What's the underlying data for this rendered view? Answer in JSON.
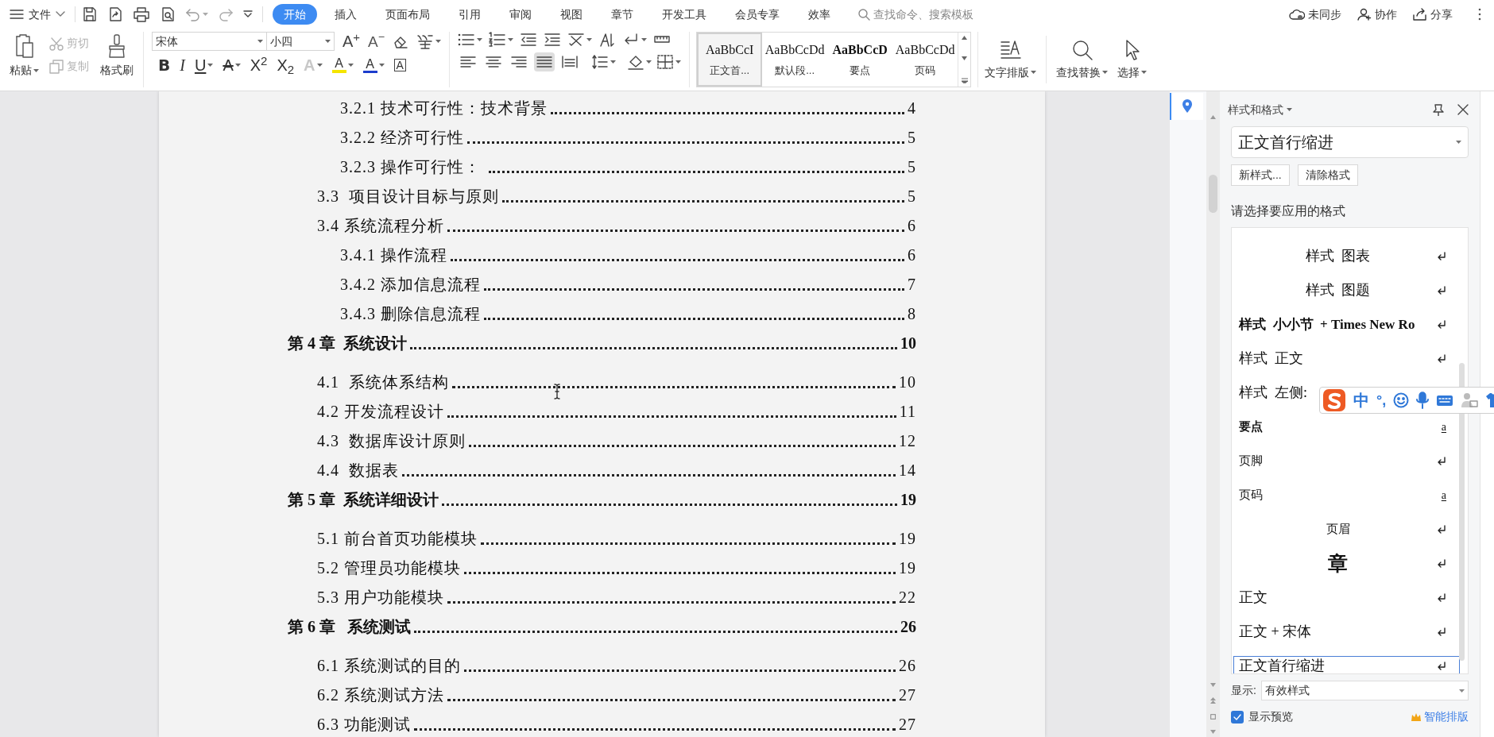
{
  "menu_bar": {
    "file_menu": "文件",
    "tabs": [
      {
        "label": "开始",
        "selected": true
      },
      {
        "label": "插入",
        "selected": false
      },
      {
        "label": "页面布局",
        "selected": false
      },
      {
        "label": "引用",
        "selected": false
      },
      {
        "label": "审阅",
        "selected": false
      },
      {
        "label": "视图",
        "selected": false
      },
      {
        "label": "章节",
        "selected": false
      },
      {
        "label": "开发工具",
        "selected": false
      },
      {
        "label": "会员专享",
        "selected": false
      },
      {
        "label": "效率",
        "selected": false
      }
    ],
    "search": {
      "placeholder": "查找命令、搜索模板"
    },
    "actions": [
      "未同步",
      "协作",
      "分享"
    ]
  },
  "ribbon": {
    "clipboard": {
      "paste": "粘贴",
      "cut": {
        "label": "剪切",
        "disabled": true
      },
      "copy": {
        "label": "复制",
        "disabled": true
      },
      "format_painter": "格式刷"
    },
    "font": {
      "name": "宋体",
      "size": "小四",
      "size_glyphs": [
        {
          "glyph": "A$^{+}$",
          "kind": "grow"
        },
        {
          "glyph": "A$^{−}$",
          "kind": "shrink"
        }
      ],
      "format_glyphs": [
        {
          "glyph": "B",
          "kind": "bold"
        },
        {
          "glyph": "I",
          "kind": "italic"
        },
        {
          "glyph": "U",
          "kind": "underline"
        },
        {
          "glyph": "A",
          "kind": "strike"
        },
        {
          "glyph": "X$^{2}$",
          "kind": "super"
        },
        {
          "glyph": "X$_{2}$",
          "kind": "sub"
        },
        {
          "glyph": "A",
          "kind": "effect"
        },
        {
          "glyph": "A",
          "kind": "highlight"
        },
        {
          "glyph": "A",
          "kind": "color"
        },
        {
          "glyph": "A",
          "kind": "border"
        }
      ]
    },
    "alignment": [
      {
        "selected": false
      },
      {
        "selected": false
      },
      {
        "selected": false
      },
      {
        "selected": true
      },
      {
        "selected": false
      }
    ],
    "styles": [
      {
        "sample": "AaBbCcI",
        "label": "正文首...",
        "kind": "normal",
        "selected": true
      },
      {
        "sample": "AaBbCcDd",
        "label": "默认段...",
        "kind": "normal",
        "selected": false
      },
      {
        "sample": "AaBbCcD",
        "label": "要点",
        "kind": "bold",
        "selected": false
      },
      {
        "sample": "AaBbCcDd",
        "label": "页码",
        "kind": "normal",
        "selected": false
      }
    ],
    "text_layout": "文字排版",
    "find_replace": "查找替换",
    "select": "选择"
  },
  "document": {
    "toc": [
      {
        "children": [
          {
            "children": [
              {
                "title": "3.2.1 技术可行性：技术背景",
                "page": "4"
              },
              {
                "title": "3.2.2 经济可行性",
                "page": "5"
              },
              {
                "title": "3.2.3 操作可行性： ",
                "page": "5"
              }
            ]
          },
          {
            "title": "3.3  项目设计目标与原则",
            "page": "5"
          },
          {
            "title": "3.4 系统流程分析",
            "page": "6",
            "children": [
              {
                "title": "3.4.1 操作流程",
                "page": "6"
              },
              {
                "title": "3.4.2 添加信息流程",
                "page": "7"
              },
              {
                "title": "3.4.3 删除信息流程",
                "page": "8"
              }
            ]
          }
        ]
      },
      {
        "title": "第 4 章  系统设计",
        "page": "10",
        "children": [
          {
            "title": "4.1  系统体系结构",
            "page": "10"
          },
          {
            "title": "4.2 开发流程设计",
            "page": "11"
          },
          {
            "title": "4.3  数据库设计原则",
            "page": "12"
          },
          {
            "title": "4.4  数据表",
            "page": "14"
          }
        ]
      },
      {
        "title": "第 5 章  系统详细设计",
        "page": "19",
        "children": [
          {
            "title": "5.1 前台首页功能模块",
            "page": "19"
          },
          {
            "title": "5.2 管理员功能模块",
            "page": "19"
          },
          {
            "title": "5.3 用户功能模块",
            "page": "22"
          }
        ]
      },
      {
        "title": "第 6 章   系统测试",
        "page": "26",
        "children": [
          {
            "title": "6.1 系统测试的目的",
            "page": "26"
          },
          {
            "title": "6.2 系统测试方法",
            "page": "27"
          },
          {
            "title": "6.3 功能测试",
            "page": "27"
          }
        ]
      }
    ]
  },
  "styles_pane": {
    "title": "样式和格式",
    "current_style": "正文首行缩进",
    "buttons": [
      "新样式...",
      "清除格式"
    ],
    "list_label": "请选择要应用的格式",
    "styles": [
      {
        "name": "样式  图表",
        "kind": "paragraph",
        "centered": true,
        "bold": false,
        "small": false,
        "large": false,
        "selected": false
      },
      {
        "name": "样式  图题",
        "kind": "paragraph",
        "centered": true,
        "bold": false,
        "small": false,
        "large": false,
        "selected": false
      },
      {
        "name": "样式  小小节  + Times New Ro",
        "kind": "paragraph",
        "centered": false,
        "bold": true,
        "small": false,
        "large": false,
        "selected": false
      },
      {
        "name": "样式  正文",
        "kind": "paragraph",
        "centered": false,
        "bold": false,
        "small": false,
        "large": false,
        "selected": false
      },
      {
        "name": "样式  左侧:",
        "centered": false,
        "bold": false,
        "small": false,
        "large": false,
        "selected": false
      },
      {
        "name": "要点",
        "kind": "character",
        "mark": "a",
        "centered": false,
        "bold": true,
        "small": true,
        "large": false,
        "selected": false
      },
      {
        "name": "页脚",
        "kind": "paragraph",
        "centered": false,
        "bold": false,
        "small": true,
        "large": false,
        "selected": false
      },
      {
        "name": "页码",
        "kind": "character",
        "mark": "a",
        "centered": false,
        "bold": false,
        "small": true,
        "large": false,
        "selected": false
      },
      {
        "name": "页眉",
        "kind": "paragraph",
        "centered": true,
        "bold": false,
        "small": true,
        "large": false,
        "selected": false
      },
      {
        "name": "章",
        "kind": "paragraph",
        "centered": true,
        "bold": true,
        "small": false,
        "large": true,
        "selected": false
      },
      {
        "name": "正文",
        "kind": "paragraph",
        "centered": false,
        "bold": false,
        "small": false,
        "large": false,
        "selected": false
      },
      {
        "name": "正文 + 宋体",
        "kind": "paragraph",
        "centered": false,
        "bold": false,
        "small": false,
        "large": false,
        "selected": false
      },
      {
        "name": "正文首行缩进",
        "kind": "paragraph",
        "centered": false,
        "bold": false,
        "small": false,
        "large": false,
        "selected": true
      }
    ],
    "show_label": "显示:",
    "show_value": "有效样式",
    "preview": {
      "label": "显示预览",
      "checked": true
    },
    "smart_layout": "智能排版"
  },
  "ime_bar": {
    "mode": "中",
    "punctuation": "°,"
  }
}
